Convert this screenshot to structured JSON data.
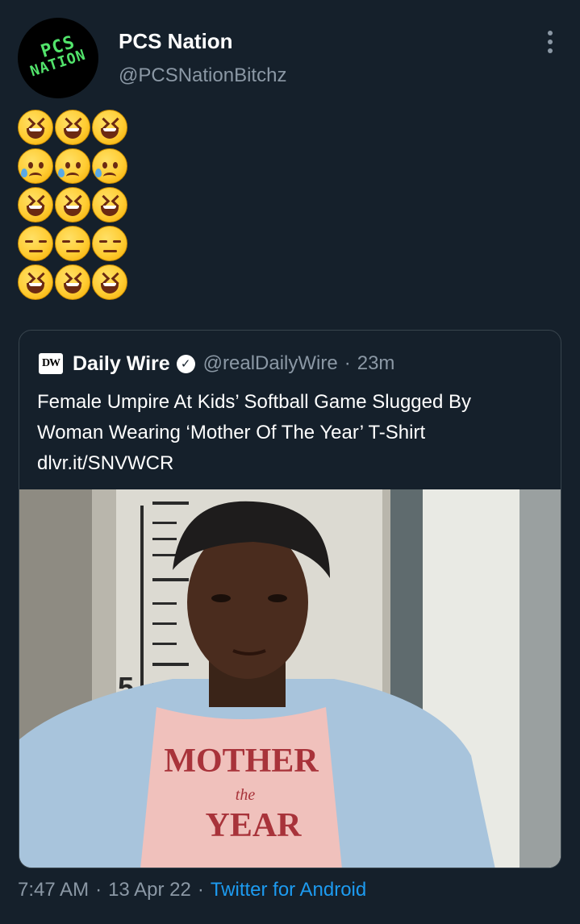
{
  "author": {
    "display_name": "PCS Nation",
    "handle": "@PCSNationBitchz",
    "avatar_text": [
      "PCS",
      "NATION"
    ]
  },
  "body": {
    "emoji_rows": [
      [
        "grinning-squinting-face",
        "grinning-squinting-face",
        "grinning-squinting-face"
      ],
      [
        "sad-but-relieved-face",
        "sad-but-relieved-face",
        "sad-but-relieved-face"
      ],
      [
        "grinning-squinting-face",
        "grinning-squinting-face",
        "grinning-squinting-face"
      ],
      [
        "expressionless-face",
        "expressionless-face",
        "expressionless-face"
      ],
      [
        "grinning-squinting-face",
        "grinning-squinting-face",
        "grinning-squinting-face"
      ]
    ]
  },
  "quoted": {
    "logo_text": "DW",
    "name": "Daily Wire",
    "handle": "@realDailyWire",
    "separator": "·",
    "time": "23m",
    "text_lines": [
      "Female Umpire At Kids’ Softball Game Slugged By",
      "Woman Wearing ‘Mother Of The Year’ T-Shirt",
      "dlvr.it/SNVWCR"
    ],
    "image": {
      "height_marker": "5",
      "shirt_lines": [
        "MOTHER",
        "the",
        "YEAR"
      ]
    }
  },
  "meta": {
    "time": "7:47 AM",
    "separator": "·",
    "date": "13 Apr 22",
    "source": "Twitter for Android"
  },
  "colors": {
    "background": "#15202b",
    "secondary_text": "#8b98a5",
    "link": "#1d9bf0",
    "border": "#38444d"
  }
}
